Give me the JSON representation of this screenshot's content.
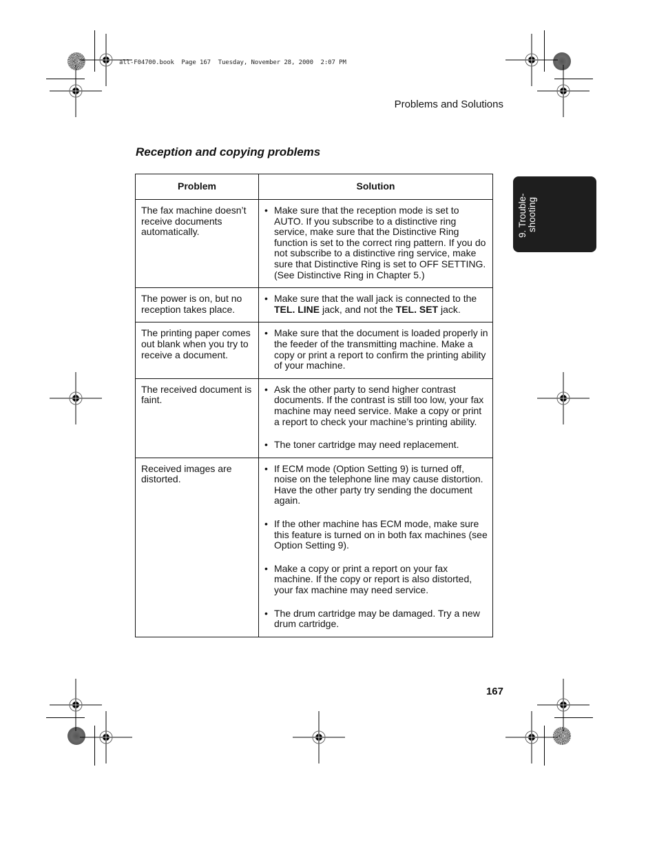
{
  "print_stamp": {
    "filename": "all-F04700.book",
    "page_label": "Page 167",
    "date": "Tuesday, November 28, 2000",
    "time": "2:07 PM"
  },
  "running_head": "Problems and Solutions",
  "section_title": "Reception and copying problems",
  "chapter_tab": {
    "line1": "9. Trouble-",
    "line2": "shooting"
  },
  "table": {
    "headers": {
      "problem": "Problem",
      "solution": "Solution"
    },
    "rows": [
      {
        "problem": "The fax machine doesn’t receive documents automatically.",
        "solutions": [
          {
            "segments": [
              {
                "text": "Make sure that the reception mode is set to AUTO. If you subscribe to a distinctive ring service, make sure that the Distinctive Ring function is set to the correct ring pattern. If you do not subscribe to a distinctive ring service, make sure that Distinctive Ring is set to OFF SETTING. (See Distinctive Ring in Chapter 5.)",
                "bold": false
              }
            ]
          }
        ]
      },
      {
        "problem": "The power is on, but no reception takes place.",
        "solutions": [
          {
            "segments": [
              {
                "text": "Make sure that the wall jack is connected to the ",
                "bold": false
              },
              {
                "text": "TEL. LINE",
                "bold": true
              },
              {
                "text": " jack, and not the ",
                "bold": false
              },
              {
                "text": "TEL. SET",
                "bold": true
              },
              {
                "text": " jack.",
                "bold": false
              }
            ]
          }
        ]
      },
      {
        "problem": "The printing paper comes out blank when you try to receive a document.",
        "solutions": [
          {
            "segments": [
              {
                "text": "Make sure that the document is loaded properly in the feeder of the transmitting machine. Make a copy or print a report to confirm the printing ability of your machine.",
                "bold": false
              }
            ]
          }
        ]
      },
      {
        "problem": "The received document is faint.",
        "solutions": [
          {
            "segments": [
              {
                "text": "Ask the other party to send higher contrast documents. If the contrast is still too low, your fax machine may need service. Make a copy or print a report to check your machine’s printing ability.",
                "bold": false
              }
            ]
          },
          {
            "segments": [
              {
                "text": "The toner cartridge may need replacement.",
                "bold": false
              }
            ]
          }
        ]
      },
      {
        "problem": "Received images are distorted.",
        "solutions": [
          {
            "segments": [
              {
                "text": "If ECM mode (Option Setting 9) is turned off, noise on the telephone line may cause distortion. Have the other party try sending the document again.",
                "bold": false
              }
            ]
          },
          {
            "segments": [
              {
                "text": "If the other machine has ECM mode, make sure this feature is turned on in both fax machines (see Option Setting 9).",
                "bold": false
              }
            ]
          },
          {
            "segments": [
              {
                "text": "Make a copy or print a report on your fax machine. If the copy or report is also distorted, your fax machine may need service.",
                "bold": false
              }
            ]
          },
          {
            "segments": [
              {
                "text": "The drum cartridge may be damaged. Try a new drum cartridge.",
                "bold": false
              }
            ]
          }
        ]
      }
    ]
  },
  "bullet_glyph": "•",
  "page_number": "167",
  "icons": {
    "registration_mark": "registration-crosshair-icon",
    "color_bar_disc": "print-density-disc-icon"
  }
}
